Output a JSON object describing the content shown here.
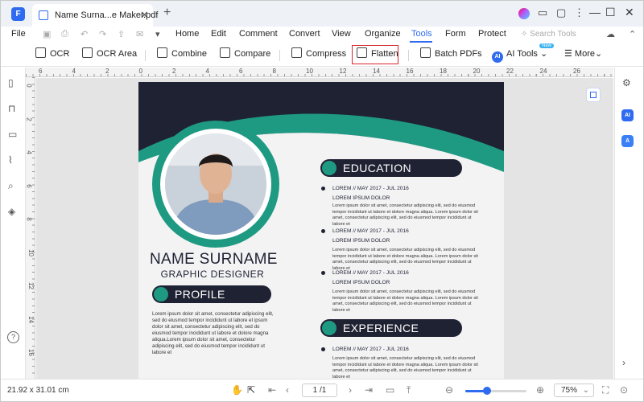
{
  "app": {
    "logo": "F"
  },
  "tab": {
    "title": "Name  Surna...e Maker.pdf",
    "close": "✕"
  },
  "titlebar": {
    "new_tab": "+",
    "minimize": "—",
    "maximize": "☐",
    "close": "✕",
    "more": "⋮"
  },
  "menubar": {
    "items": [
      "File",
      "Home",
      "Edit",
      "Comment",
      "Convert",
      "View",
      "Organize",
      "Tools",
      "Form",
      "Protect"
    ],
    "active": "Tools",
    "search_placeholder": "Search Tools"
  },
  "ribbon": {
    "ocr": "OCR",
    "ocr_area": "OCR Area",
    "combine": "Combine",
    "compare": "Compare",
    "compress": "Compress",
    "flatten": "Flatten",
    "batch_pdfs": "Batch PDFs",
    "ai_tools": "AI Tools",
    "ai_tools_caret": "⌄",
    "new_badge": "New",
    "more": "More",
    "more_caret": "⌄",
    "highlight_color": "#d9272e"
  },
  "ruler": {
    "h_labels": [
      "6",
      "4",
      "2",
      "0",
      "2",
      "4",
      "6",
      "8",
      "10",
      "12",
      "14",
      "16",
      "18",
      "20",
      "22",
      "24",
      "26"
    ],
    "v_labels": [
      "0",
      "2",
      "4",
      "6",
      "8",
      "10",
      "12",
      "14",
      "16"
    ]
  },
  "resume": {
    "name": "NAME SURNAME",
    "role": "GRAPHIC DESIGNER",
    "profile_heading": "PROFILE",
    "profile_text": "Lorem ipsum dolor sit amet, consectetur adipiscing elit, sed do eiusmod tempor incididunt ut labore et ipsum dolor sit amet, consectetur adipiscing elit, sed do eiusmod tempor incididunt ut labore et dolore magna aliqua.Lorem ipsum dolor sit amet, consectetur adipiscing elit, sed do eiusmod tempor incididunt ut labore et",
    "education_heading": "EDUCATION",
    "experience_heading": "EXPERIENCE",
    "education": [
      {
        "date": "LOREM // MAY 2017 - JUL 2016",
        "title": "LOREM IPSUM DOLOR",
        "text": "Lorem ipsum dolor sit amet, consectetur adipiscing elit, sed do eiusmod tempor incididunt ut labore et dolore magna aliqua. Lorem ipsum dolor sit amet, consectetur adipiscing elit, sed do eiusmod tempor incididunt ut labore et"
      },
      {
        "date": "LOREM // MAY 2017 - JUL 2016",
        "title": "LOREM IPSUM DOLOR",
        "text": "Lorem ipsum dolor sit amet, consectetur adipiscing elit, sed do eiusmod tempor incididunt ut labore et dolore magna aliqua. Lorem ipsum dolor sit amet, consectetur adipiscing elit, sed do eiusmod tempor incididunt ut labore et"
      },
      {
        "date": "LOREM // MAY 2017 - JUL 2016",
        "title": "LOREM IPSUM DOLOR",
        "text": "Lorem ipsum dolor sit amet, consectetur adipiscing elit, sed do eiusmod tempor incididunt ut labore et dolore magna aliqua. Lorem ipsum dolor sit amet, consectetur adipiscing elit, sed do eiusmod tempor incididunt ut labore et"
      }
    ],
    "experience": [
      {
        "date": "LOREM // MAY 2017 - JUL 2016",
        "text": "Lorem ipsum dolor sit amet, consectetur adipiscing elit, sed do eiusmod tempor incididunt ut labore et dolore magna aliqua. Lorem ipsum dolor sit amet, consectetur adipiscing elit, sed do eiusmod tempor incididunt ut labore et"
      }
    ],
    "accent_color": "#1f9a82",
    "dark_color": "#1f2233"
  },
  "status": {
    "page_size": "21.92 x 31.01 cm",
    "page_indicator": "1 /1",
    "zoom": "75%",
    "zoom_caret": "⌄",
    "zoom_level": 0.35
  }
}
